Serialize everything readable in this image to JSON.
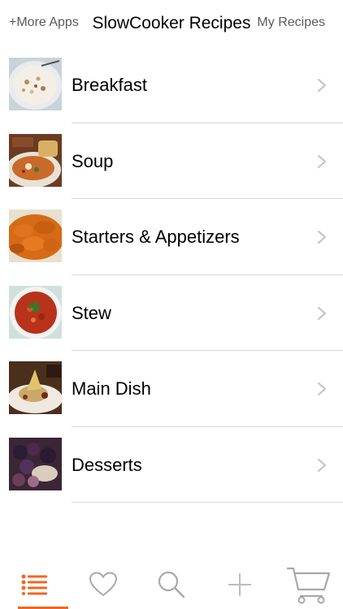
{
  "header": {
    "left_label": "+More Apps",
    "title": "SlowCooker Recipes",
    "right_label": "My Recipes"
  },
  "categories": [
    {
      "label": "Breakfast",
      "icon": "chevron-right-icon"
    },
    {
      "label": "Soup",
      "icon": "chevron-right-icon"
    },
    {
      "label": "Starters & Appetizers",
      "icon": "chevron-right-icon"
    },
    {
      "label": "Stew",
      "icon": "chevron-right-icon"
    },
    {
      "label": "Main Dish",
      "icon": "chevron-right-icon"
    },
    {
      "label": "Desserts",
      "icon": "chevron-right-icon"
    }
  ],
  "tabbar": {
    "tabs": [
      {
        "name": "list-icon",
        "active": true
      },
      {
        "name": "heart-icon",
        "active": false
      },
      {
        "name": "search-icon",
        "active": false
      },
      {
        "name": "plus-icon",
        "active": false
      },
      {
        "name": "cart-icon",
        "active": false
      }
    ]
  },
  "colors": {
    "accent": "#f26522",
    "separator": "#d9d9d9",
    "chevron": "#c7c7cc",
    "tab_icon": "#a8a8a8"
  }
}
